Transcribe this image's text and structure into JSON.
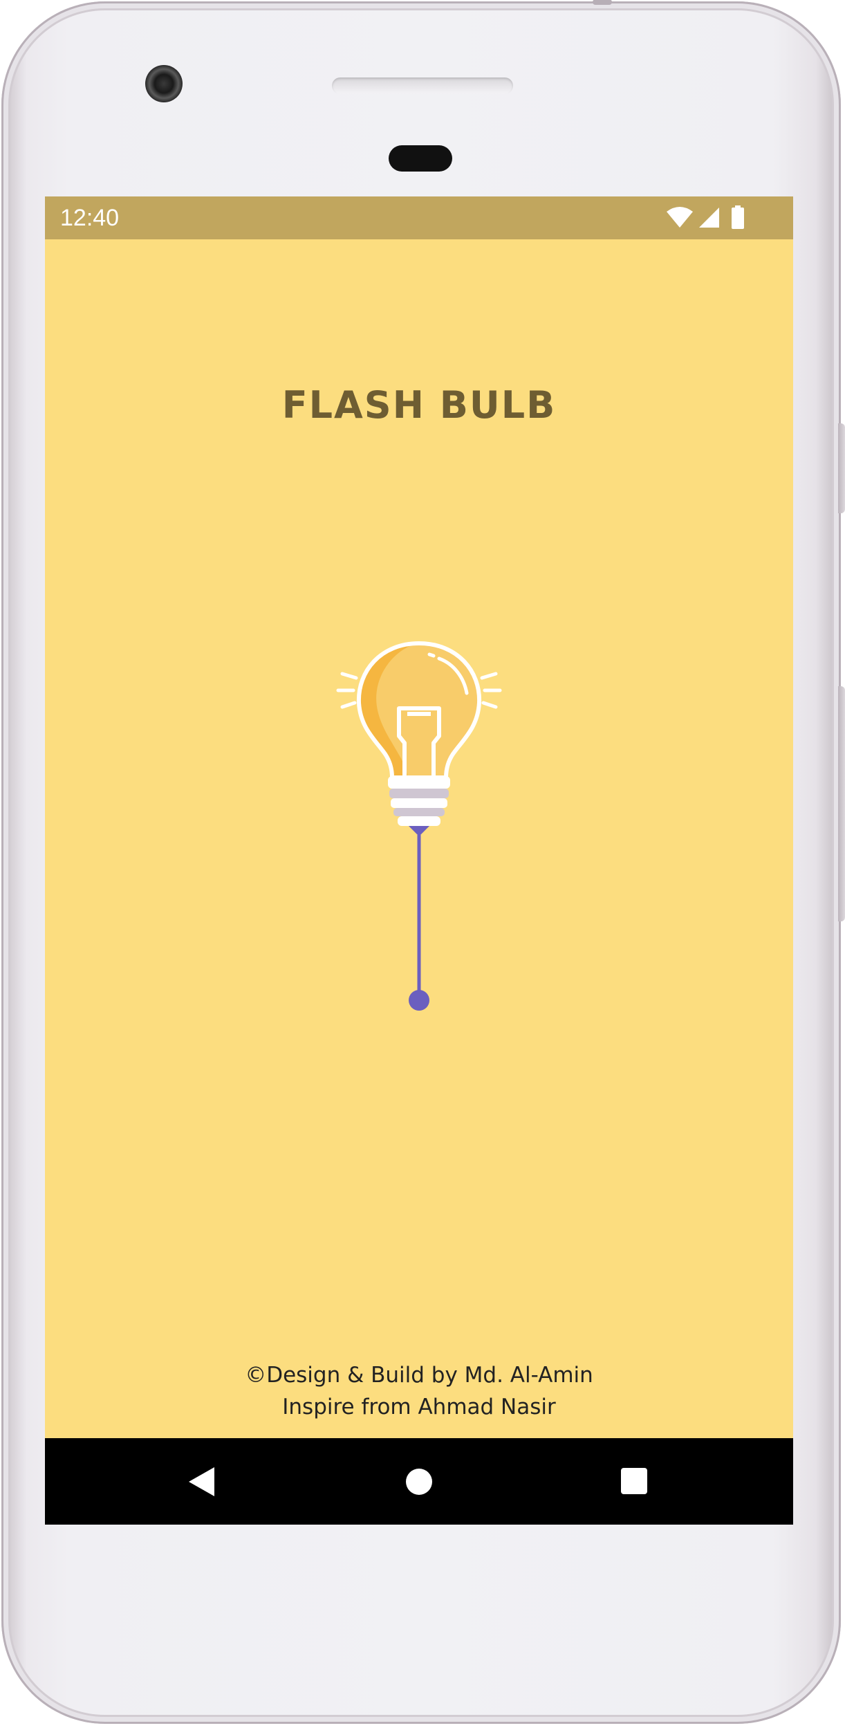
{
  "status_bar": {
    "time": "12:40",
    "icons": [
      "wifi-icon",
      "cell-signal-icon",
      "battery-icon"
    ],
    "color": "#c1a65e"
  },
  "app": {
    "title": "FLASH BULB",
    "background": "#fcdd7f",
    "title_color": "#6e5d32"
  },
  "bulb": {
    "icon": "light-bulb-icon",
    "state": "off",
    "pull_cord_color": "#6b5fbf"
  },
  "footer": {
    "credit_line": "©Design & Build by Md. Al-Amin",
    "inspire_line": "Inspire from Ahmad Nasir"
  },
  "nav_bar": {
    "buttons": [
      "back-icon",
      "home-icon",
      "recent-apps-icon"
    ]
  }
}
